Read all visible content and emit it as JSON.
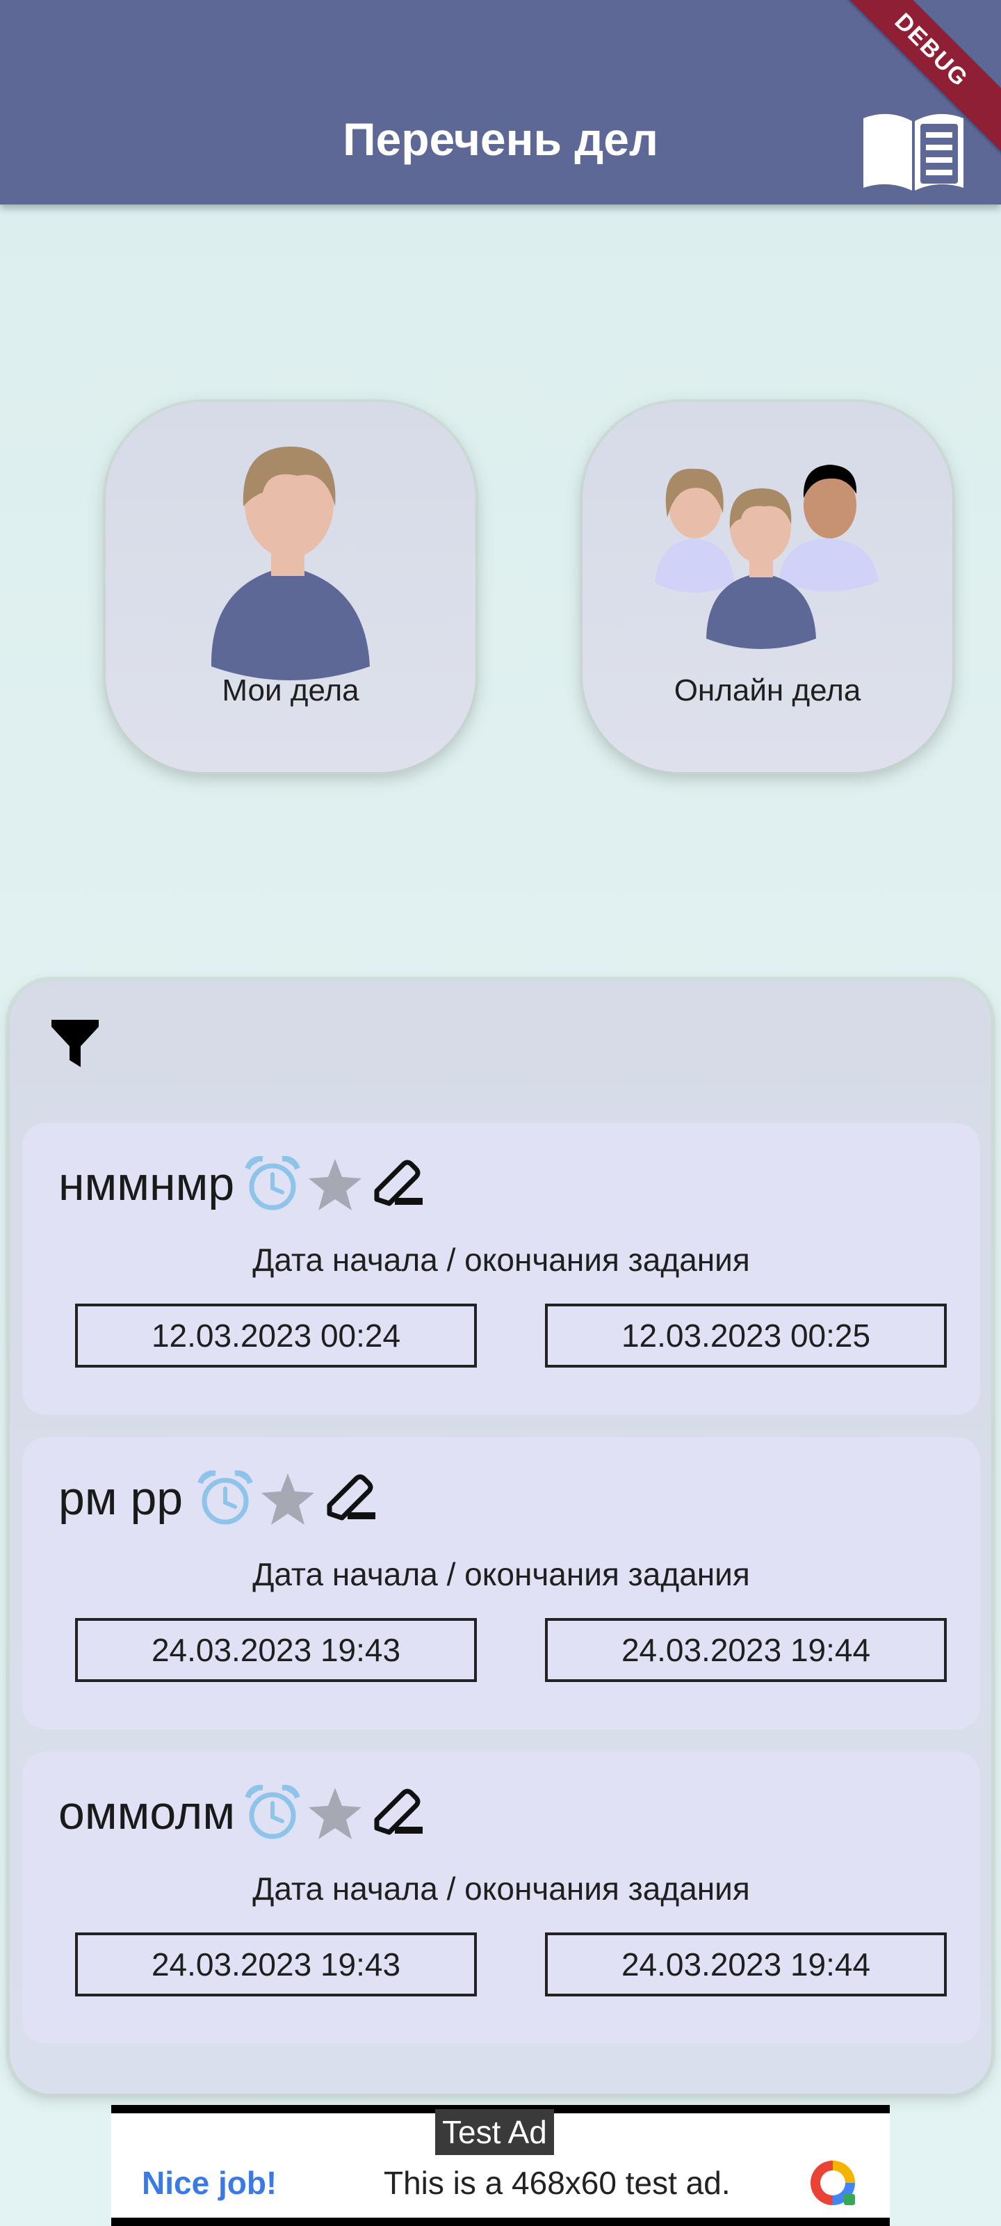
{
  "appbar": {
    "title": "Перечень дел",
    "debug_label": "DEBUG"
  },
  "modes": [
    {
      "label": "Мои дела"
    },
    {
      "label": "Онлайн дела"
    }
  ],
  "tasks": [
    {
      "title": "нммнмр",
      "caption": "Дата начала / окончания задания",
      "start": "12.03.2023  00:24",
      "end": "12.03.2023  00:25"
    },
    {
      "title": "рм рр",
      "caption": "Дата начала / окончания задания",
      "start": "24.03.2023  19:43",
      "end": "24.03.2023  19:44"
    },
    {
      "title": "оммолм",
      "caption": "Дата начала / окончания задания",
      "start": "24.03.2023  19:43",
      "end": "24.03.2023  19:44"
    }
  ],
  "ad": {
    "tag": "Test Ad",
    "headline": "Nice job!",
    "text": "This is a 468x60 test ad."
  },
  "colors": {
    "appbar": "#5d6896",
    "background": "#e2f1f1",
    "alarm": "#8ec4ea",
    "star": "#a6a8b3"
  },
  "icons": [
    "book-icon",
    "filter-icon",
    "alarm-clock-icon",
    "star-icon",
    "edit-icon"
  ]
}
